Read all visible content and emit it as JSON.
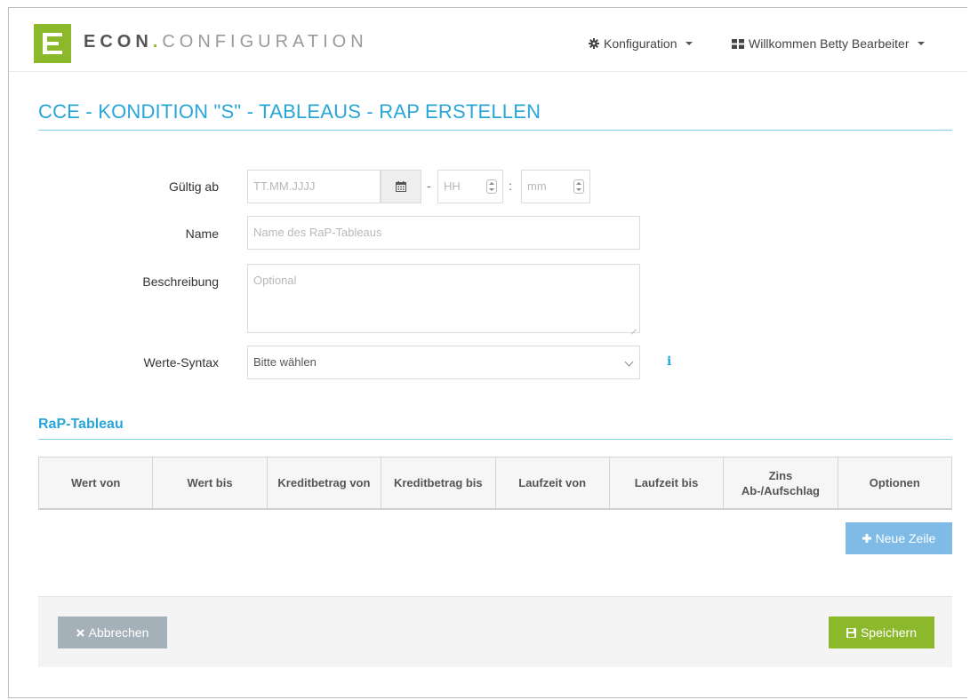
{
  "navbar": {
    "brand_main": "ECON",
    "brand_dot": ".",
    "brand_rest": "CONFIGURATION",
    "config_label": "Konfiguration",
    "user_label": "Willkommen Betty Bearbeiter"
  },
  "page": {
    "title": "CCE - KONDITION \"S\" - TABLEAUS - RAP ERSTELLEN"
  },
  "form": {
    "valid_from_label": "Gültig ab",
    "date_placeholder": "TT.MM.JJJJ",
    "hour_placeholder": "HH",
    "minute_placeholder": "mm",
    "dash": "-",
    "colon": ":",
    "name_label": "Name",
    "name_placeholder": "Name des RaP-Tableaus",
    "description_label": "Beschreibung",
    "description_placeholder": "Optional",
    "syntax_label": "Werte-Syntax",
    "syntax_value": "Bitte wählen",
    "info_glyph": "i"
  },
  "table": {
    "section_title": "RaP-Tableau",
    "columns": [
      "Wert von",
      "Wert bis",
      "Kreditbetrag von",
      "Kreditbetrag bis",
      "Laufzeit von",
      "Laufzeit bis",
      "Zins Ab-/Aufschlag",
      "Optionen"
    ],
    "new_row_label": "Neue Zeile"
  },
  "footer": {
    "cancel_label": "Abbrechen",
    "save_label": "Speichern"
  },
  "colors": {
    "brand_green": "#8cb82c",
    "accent_blue": "#29a6d9",
    "button_blue": "#7fbbe6",
    "button_grey": "#a5b1b8"
  }
}
